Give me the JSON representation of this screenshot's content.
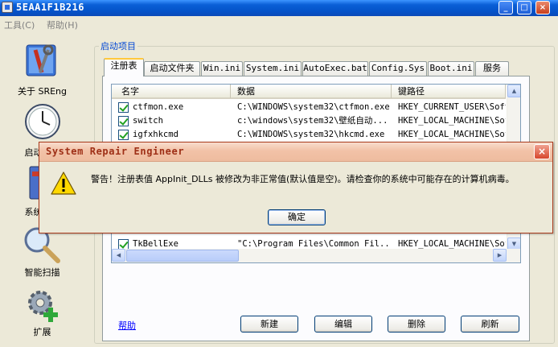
{
  "window": {
    "title": "5EAA1F1B216",
    "icon": "app-icon",
    "controls": [
      "minimize-icon",
      "maximize-icon",
      "close-icon"
    ]
  },
  "menu": {
    "tools": "工具(C)",
    "help": "帮助(H)"
  },
  "nav": {
    "items": [
      {
        "label": "关于 SREng",
        "icon": "toolbox-icon"
      },
      {
        "label": "启动项目",
        "icon": "clock-icon"
      },
      {
        "label": "系统修复",
        "icon": "system-icon"
      },
      {
        "label": "智能扫描",
        "icon": "magnifier-icon"
      },
      {
        "label": "扩展",
        "icon": "gear-plus-icon"
      }
    ]
  },
  "group": {
    "label": "启动项目"
  },
  "tabs": [
    {
      "label": "注册表",
      "active": true
    },
    {
      "label": "启动文件夹",
      "active": false
    },
    {
      "label": "Win.ini",
      "active": false
    },
    {
      "label": "System.ini",
      "active": false
    },
    {
      "label": "AutoExec.bat",
      "active": false
    },
    {
      "label": "Config.Sys",
      "active": false
    },
    {
      "label": "Boot.ini",
      "active": false
    },
    {
      "label": "服务",
      "active": false
    }
  ],
  "list": {
    "columns": [
      "名字",
      "数据",
      "键路径"
    ],
    "rows": [
      {
        "name": "ctfmon.exe",
        "data": "C:\\WINDOWS\\system32\\ctfmon.exe",
        "path": "HKEY_CURRENT_USER\\Soft",
        "checked": true
      },
      {
        "name": "switch",
        "data": "c:\\windows\\system32\\壁纸自动...",
        "path": "HKEY_LOCAL_MACHINE\\Sof",
        "checked": true
      },
      {
        "name": "igfxhkcmd",
        "data": "C:\\WINDOWS\\system32\\hkcmd.exe",
        "path": "HKEY_LOCAL_MACHINE\\Sof",
        "checked": true
      },
      {
        "name": "TkBellExe",
        "data": "\"C:\\Program Files\\Common Fil...",
        "path": "HKEY_LOCAL_MACHINE\\Sof",
        "checked": true
      }
    ]
  },
  "buttons": {
    "help": "帮助",
    "new": "新建",
    "edit": "编辑",
    "delete": "删除",
    "refresh": "刷新"
  },
  "dialog": {
    "title": "System Repair Engineer",
    "message": "警告！注册表值 AppInit_DLLs 被修改为非正常值(默认值是空)。请检查你的系统中可能存在的计算机病毒。",
    "ok": "确定",
    "icon": "warning-icon",
    "close_icon": "close-icon"
  },
  "colors": {
    "title_blue": "#0a5fd6",
    "dialog_title": "#f2c2a7",
    "dialog_title_text": "#9e2f16",
    "group_label": "#0046d5",
    "check_green": "#21a121"
  }
}
